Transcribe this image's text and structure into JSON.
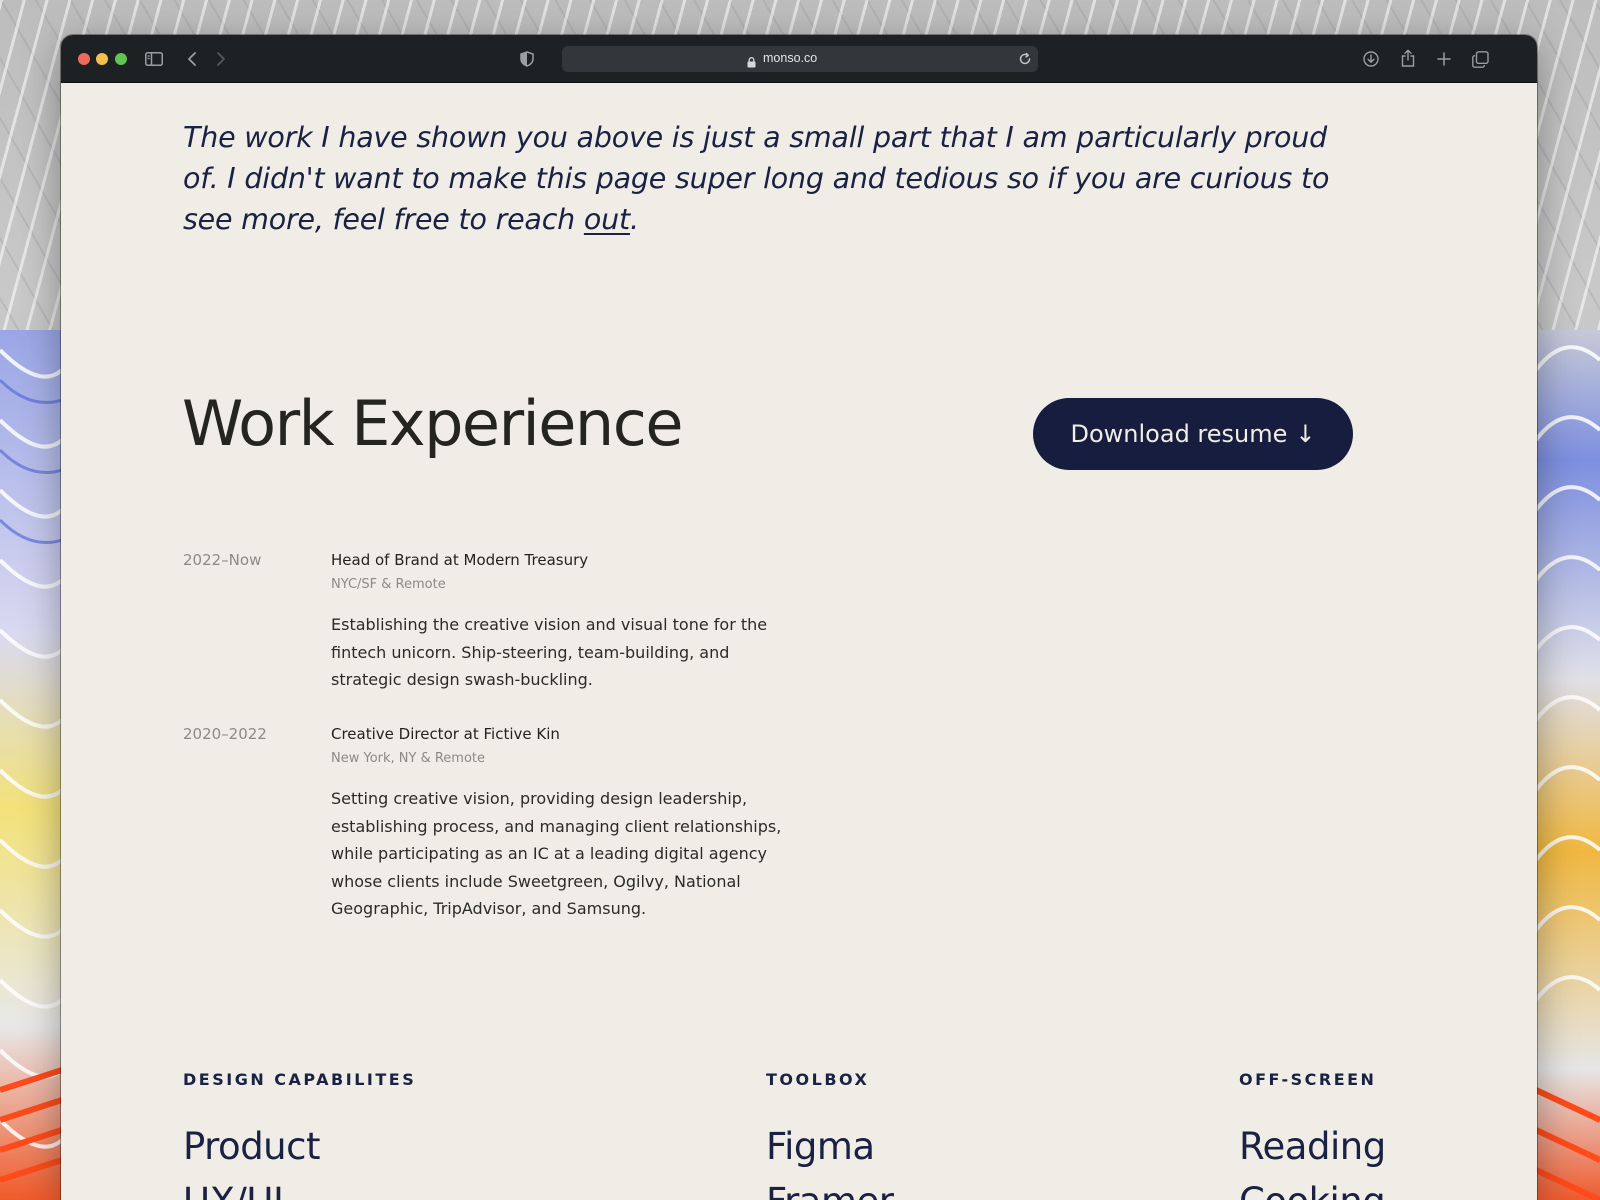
{
  "browser": {
    "url": "monso.co",
    "icons": {
      "sidebar": "sidebar-icon",
      "back": "chevron-left-icon",
      "forward": "chevron-right-icon",
      "shield": "shield-icon",
      "lock": "lock-icon",
      "reload": "reload-icon",
      "download": "download-icon",
      "share": "share-icon",
      "new_tab": "plus-icon",
      "tabs": "tabs-overview-icon"
    }
  },
  "intro": {
    "text_before_link": "The work I have shown you above is just a small part that I am particularly proud of. I didn't want to make this page super long and tedious so if you are curious to see more, feel free to reach ",
    "link_text": "out",
    "text_after_link": "."
  },
  "experience": {
    "heading": "Work Experience",
    "resume_button_label": "Download resume",
    "resume_button_arrow": "↓",
    "jobs": [
      {
        "years": "2022–Now",
        "title": "Head of Brand at Modern Treasury",
        "location": "NYC/SF & Remote",
        "description": "Establishing the creative vision and visual tone for the fintech unicorn. Ship-steering, team-building, and strategic design swash-buckling."
      },
      {
        "years": "2020–2022",
        "title": "Creative Director at Fictive Kin",
        "location": "New York, NY & Remote",
        "description": "Setting creative vision, providing design leadership, establishing process, and managing client relationships, while participating as an IC at a leading digital agency whose clients include Sweetgreen, Ogilvy, National Geographic, TripAdvisor, and Samsung."
      }
    ]
  },
  "capabilities": {
    "label": "DESIGN CAPABILITES",
    "items": [
      "Product",
      "UX/UI"
    ]
  },
  "toolbox": {
    "label": "TOOLBOX",
    "items": [
      "Figma",
      "Framer"
    ]
  },
  "off_screen": {
    "label": "OFF-SCREEN",
    "items": [
      "Reading",
      "Cooking"
    ]
  },
  "colors": {
    "page_background": "#f0ede6",
    "navy_text": "#1a2143",
    "button_background": "#161d3f",
    "titlebar": "#1e2124"
  }
}
